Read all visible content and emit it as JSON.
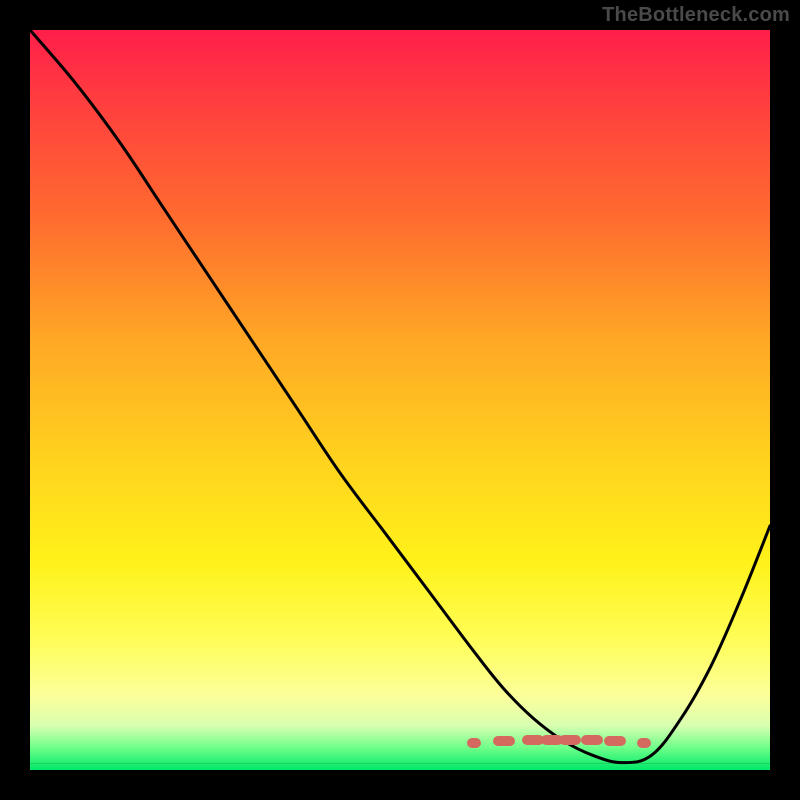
{
  "watermark": "TheBottleneck.com",
  "colors": {
    "background": "#000000",
    "curve_stroke": "#000000",
    "tick": "#d46a5f",
    "watermark_text": "#4a4a4a"
  },
  "chart_data": {
    "type": "line",
    "title": "",
    "xlabel": "",
    "ylabel": "",
    "xlim": [
      0,
      100
    ],
    "ylim": [
      0,
      100
    ],
    "grid": false,
    "legend": false,
    "series": [
      {
        "name": "bottleneck-curve",
        "x": [
          0,
          6,
          12,
          18,
          24,
          30,
          36,
          42,
          48,
          54,
          60,
          64,
          68,
          72,
          76,
          80,
          84,
          88,
          92,
          96,
          100
        ],
        "values": [
          100,
          93,
          85,
          76,
          67,
          58,
          49,
          40,
          32,
          24,
          16,
          11,
          7,
          4,
          2,
          1,
          2,
          7,
          14,
          23,
          33
        ]
      }
    ],
    "annotations": {
      "valley_ticks_x": [
        60,
        64,
        68,
        70.5,
        73,
        76,
        79,
        83
      ],
      "valley_ticks_y_percent_from_top": 96
    },
    "gradient_stops": [
      {
        "pos": 0,
        "color": "#ff1e4a"
      },
      {
        "pos": 10,
        "color": "#ff3f3f"
      },
      {
        "pos": 25,
        "color": "#ff6a2f"
      },
      {
        "pos": 42,
        "color": "#ffa825"
      },
      {
        "pos": 58,
        "color": "#ffd21e"
      },
      {
        "pos": 72,
        "color": "#fff21a"
      },
      {
        "pos": 82,
        "color": "#fffd55"
      },
      {
        "pos": 90,
        "color": "#fcff9a"
      },
      {
        "pos": 94,
        "color": "#d8ffb0"
      },
      {
        "pos": 97,
        "color": "#6fff8a"
      },
      {
        "pos": 100,
        "color": "#00e868"
      }
    ]
  }
}
